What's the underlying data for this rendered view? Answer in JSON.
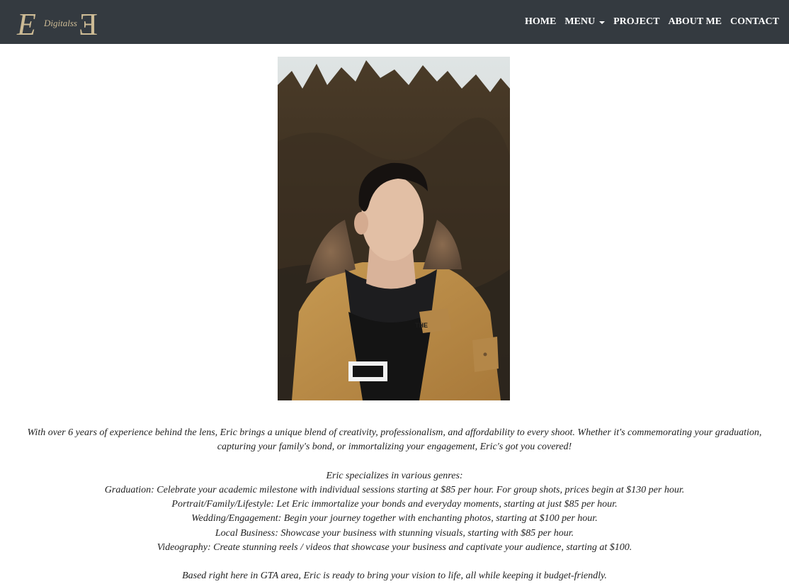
{
  "brand": {
    "logo_letters": "EƎ",
    "logo_script": "Digitalss",
    "logo_color": "#cdbb95"
  },
  "nav": {
    "home": "HOME",
    "menu": "MENU",
    "project": "PROJECT",
    "about": "ABOUT ME",
    "contact": "CONTACT"
  },
  "hero_image": {
    "subject": "portrait of a man in a tan parka with fur hood in front of evergreen trees"
  },
  "about": {
    "intro": "With over 6 years of experience behind the lens, Eric brings a unique blend of creativity, professionalism, and affordability to every shoot. Whether it's commemorating your graduation, capturing your family's bond, or immortalizing your engagement, Eric's got you covered!",
    "genres_heading": "Eric specializes in various genres:",
    "genres": [
      "Graduation: Celebrate your academic milestone with individual sessions starting at $85 per hour. For group shots, prices begin at $130 per hour.",
      "Portrait/Family/Lifestyle: Let Eric immortalize your bonds and everyday moments, starting at just $85 per hour.",
      "Wedding/Engagement: Begin your journey together with enchanting photos, starting at $100 per hour.",
      "Local Business: Showcase your business with stunning visuals, starting with $85 per hour.",
      "Videography: Create stunning reels / videos that showcase your business and captivate your audience, starting at $100."
    ],
    "closing": "Based right here in GTA area, Eric is ready to bring your vision to life, all while keeping it budget-friendly."
  },
  "colors": {
    "navbar_bg": "#343a40",
    "nav_text": "#ffffff",
    "body_text": "#222222"
  }
}
